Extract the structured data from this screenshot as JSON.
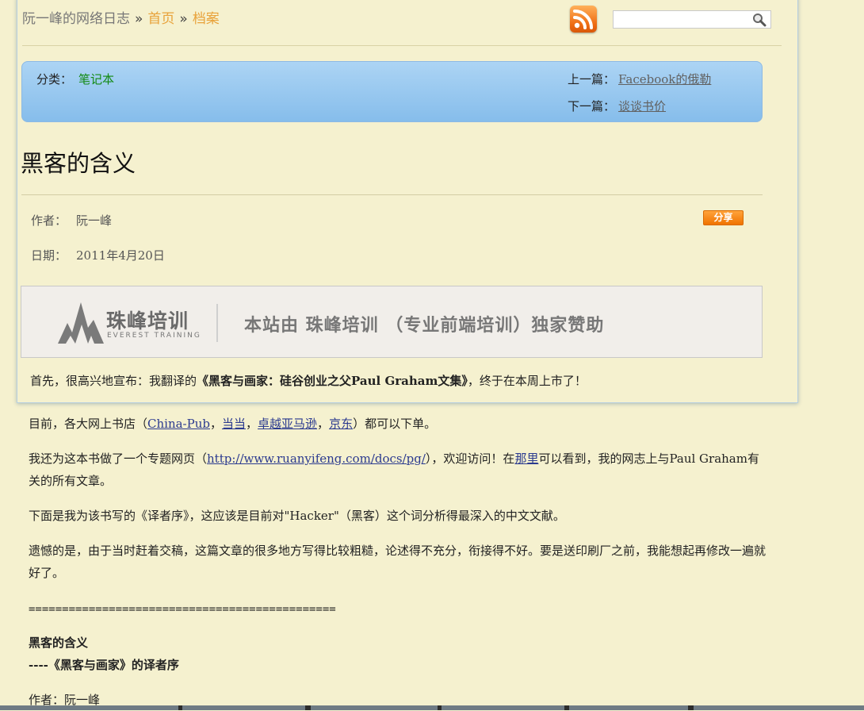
{
  "header": {
    "site_title": "阮一峰的网络日志",
    "sep": "»",
    "breadcrumb": [
      "首页",
      "档案"
    ],
    "search_placeholder": "",
    "rss_icon": "rss-icon",
    "search_icon": "magnifier-icon"
  },
  "meta_bar": {
    "category_label": "分类：",
    "category_value": "笔记本",
    "prev_label": "上一篇：",
    "prev_title": "Facebook的俄勒",
    "next_label": "下一篇：",
    "next_title": "谈谈书价"
  },
  "post": {
    "title": "黑客的含义",
    "author_label": "作者：",
    "author": "阮一峰",
    "date_label": "日期：",
    "date": "2011年4月20日",
    "share_label": "分享"
  },
  "banner": {
    "brand": "珠峰培训",
    "brand_en": "EVEREST TRAINING",
    "slogan": "本站由 珠峰培训 （专业前端培训）独家赞助"
  },
  "body": {
    "p1_pre": "首先，很高兴地宣布：我翻译的",
    "p1_book": "《黑客与画家：硅谷创业之父Paul Graham文集》",
    "p1_post": "，终于在本周上市了！",
    "p2_pre": "目前，各大网上书店（",
    "p2_links": [
      "China-Pub",
      "当当",
      "卓越亚马逊",
      "京东"
    ],
    "p2_comma": "，",
    "p2_post": "）都可以下单。",
    "p3_pre": "我还为这本书做了一个专题网页（",
    "p3_url": "http://www.ruanyifeng.com/docs/pg/",
    "p3_mid": "），欢迎访问！在",
    "p3_link": "那里",
    "p3_post": "可以看到，我的网志上与Paul Graham有关的所有文章。",
    "p4": "下面是我为该书写的《译者序》，这应该是目前对\"Hacker\"（黑客）这个词分析得最深入的中文文献。",
    "p5": "遗憾的是，由于当时赶着交稿，这篇文章的很多地方写得比较粗糙，论述得不充分，衔接得不好。要是送印刷厂之前，我能想起再修改一遍就好了。",
    "separator": "==============================================",
    "sub_title": "黑客的含义",
    "sub_title2": "----《黑客与画家》的译者序",
    "author_line": "作者：阮一峰"
  },
  "colors": {
    "background": "#f5f1cf",
    "breadcrumb_link": "#e8a23a",
    "category_link": "#138a13",
    "meta_bar_blue": "#86bdeb",
    "share_orange": "#f07300",
    "body_link": "#2b3a8f"
  }
}
